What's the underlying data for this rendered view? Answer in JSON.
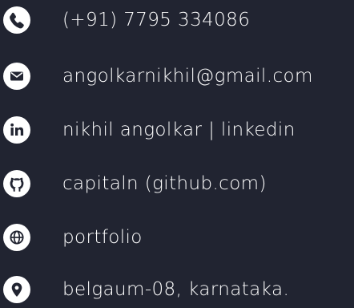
{
  "contacts": {
    "phone": {
      "label": "(+91) 7795 334086",
      "icon": "phone-icon"
    },
    "email": {
      "label": "angolkarnikhil@gmail.com",
      "icon": "envelope-icon"
    },
    "linkedin": {
      "label": "nikhil angolkar | linkedin",
      "icon": "linkedin-icon"
    },
    "github": {
      "label": "capitaln (github.com)",
      "icon": "github-icon"
    },
    "portfolio": {
      "label": "portfolio",
      "icon": "globe-icon"
    },
    "location": {
      "label": "belgaum-08, karnataka.",
      "icon": "map-pin-icon"
    }
  },
  "colors": {
    "background": "#212431",
    "foreground": "#ffffff"
  }
}
